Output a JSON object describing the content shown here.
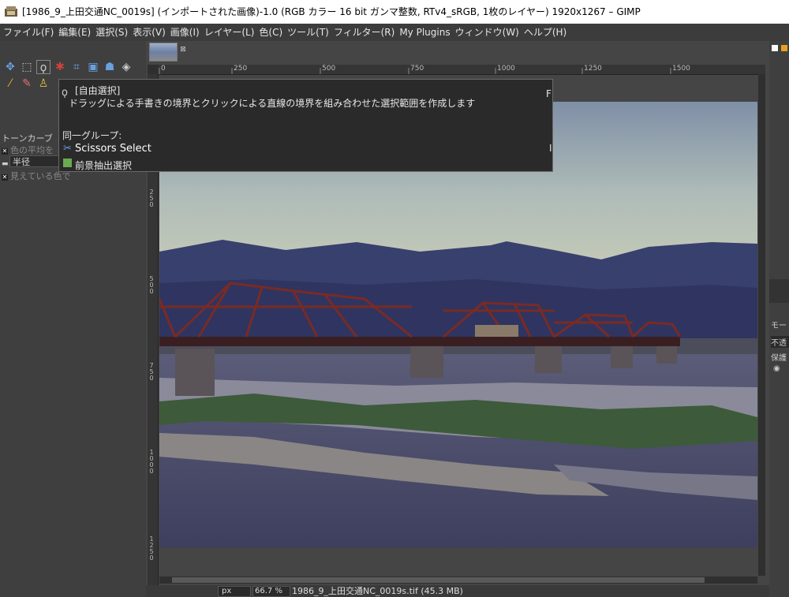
{
  "window": {
    "title": "[1986_9_上田交通NC_0019s] (インポートされた画像)-1.0 (RGB カラー 16 bit ガンマ整数, RTv4_sRGB, 1枚のレイヤー) 1920x1267 – GIMP"
  },
  "menu": [
    "ファイル(F)",
    "編集(E)",
    "選択(S)",
    "表示(V)",
    "画像(I)",
    "レイヤー(L)",
    "色(C)",
    "ツール(T)",
    "フィルター(R)",
    "My Plugins",
    "ウィンドウ(W)",
    "ヘルプ(H)"
  ],
  "tool_options": {
    "panel_title": "トーンカーブ",
    "sample_average_label": "色の平均を",
    "radius_label": "半径",
    "visible_colors_label": "見えている色で"
  },
  "tooltip": {
    "title": "[自由選択]",
    "description": "ドラッグによる手書きの境界とクリックによる直線の境界を組み合わせた選択範囲を作成します",
    "shortcut": "F",
    "group_header": "同一グループ:",
    "items": [
      "Scissors Select",
      "前景抽出選択"
    ],
    "item_shortcut": "I"
  },
  "rulers": {
    "h_ticks": [
      "0",
      "250",
      "500",
      "750",
      "1000",
      "1250",
      "1500"
    ],
    "v_ticks": [
      "250",
      "500",
      "750",
      "1000",
      "1250"
    ]
  },
  "statusbar": {
    "unit": "px",
    "zoom": "66.7 %",
    "filename": "1986_9_上田交通NC_0019s.tif (45.3 MB)"
  },
  "right_dock": {
    "mode_label": "モー",
    "opacity_label": "不透",
    "lock_label": "保護"
  },
  "colors": {
    "bg": "#454545",
    "panel": "#3f3f3f",
    "tooltip_bg": "#2a2a2a",
    "accent_orange": "#e8a020"
  }
}
